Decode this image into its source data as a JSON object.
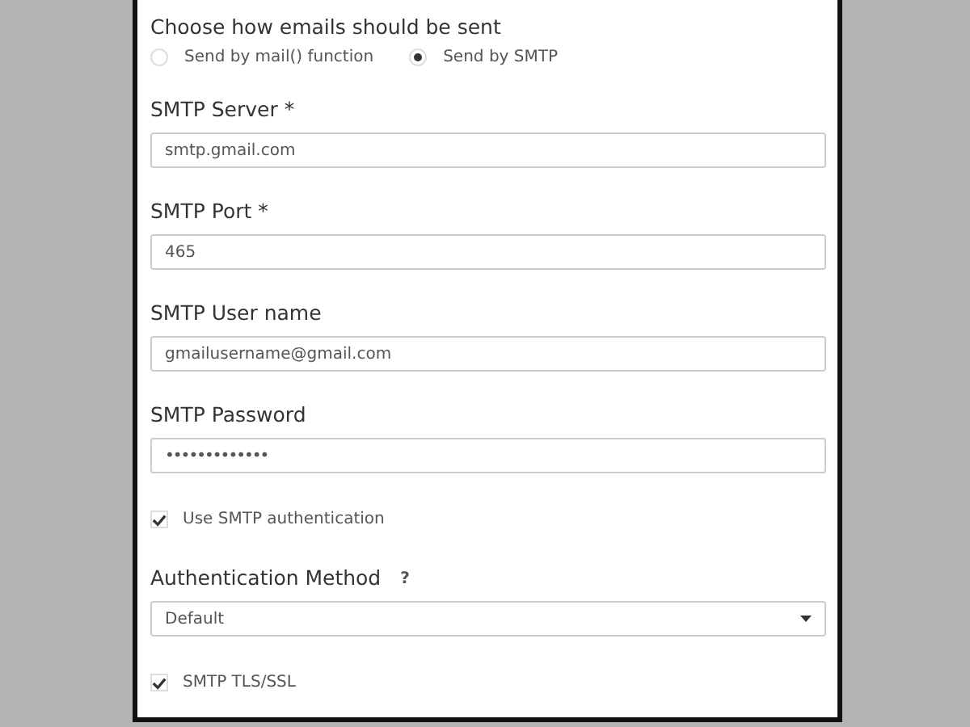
{
  "send_method": {
    "label": "Choose how emails should be sent",
    "options": [
      {
        "label": "Send by mail() function",
        "selected": false
      },
      {
        "label": "Send by SMTP",
        "selected": true
      }
    ]
  },
  "settings": [
    {
      "kind": "text",
      "label": "SMTP Server *",
      "value": "smtp.gmail.com"
    },
    {
      "kind": "text",
      "label": "SMTP Port *",
      "value": "465"
    },
    {
      "kind": "text",
      "label": "SMTP User name",
      "value": "gmailusername@gmail.com"
    },
    {
      "kind": "password",
      "label": "SMTP Password",
      "value": "•••••••••••••"
    },
    {
      "kind": "checkbox",
      "label": "Use SMTP authentication",
      "checked": true
    },
    {
      "kind": "select",
      "label": "Authentication Method",
      "help": "?",
      "value": "Default"
    },
    {
      "kind": "checkbox",
      "label": "SMTP TLS/SSL",
      "checked": true
    }
  ]
}
